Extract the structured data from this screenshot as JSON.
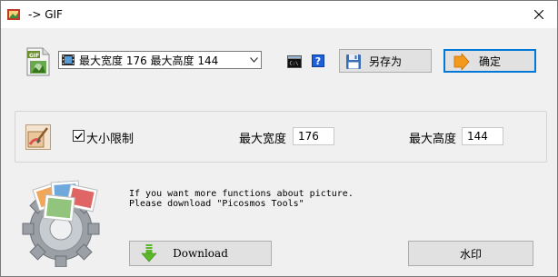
{
  "window": {
    "title": "-> GIF"
  },
  "format": {
    "selected": "最大宽度 176 最大高度 144"
  },
  "toolbar": {
    "saveas_label": "另存为",
    "ok_label": "确定",
    "help_label": "?"
  },
  "resize": {
    "checkbox_label": "大小限制",
    "checked": true,
    "width_label": "最大宽度",
    "width_value": "176",
    "height_label": "最大高度",
    "height_value": "144"
  },
  "promo": {
    "line1": "If you want more functions about picture.",
    "line2": "Please download \"Picosmos Tools\""
  },
  "buttons": {
    "download_label": "Download",
    "watermark_label": "水印"
  },
  "icons": {
    "app": "app-icon",
    "close": "close-icon",
    "gif": "gif-file-icon",
    "film": "film-icon",
    "cmd": "command-prompt-icon",
    "help": "help-icon",
    "save": "floppy-disk-icon",
    "ok": "orange-arrow-icon",
    "brush": "paint-brush-icon",
    "download": "green-down-arrow-icon",
    "logo": "picosmos-gear-logo"
  },
  "colors": {
    "accent": "#0078d7",
    "download_arrow": "#5cb82a",
    "ok_arrow": "#f39a1e"
  }
}
